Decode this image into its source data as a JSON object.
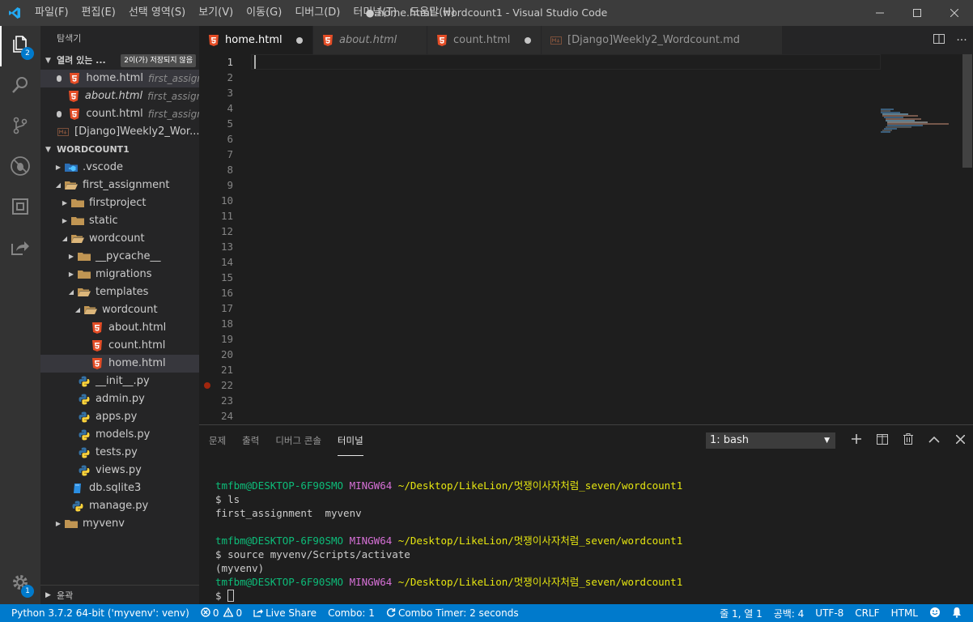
{
  "window": {
    "title": "● home.html - wordcount1 - Visual Studio Code",
    "menu": [
      "파일(F)",
      "편집(E)",
      "선택 영역(S)",
      "보기(V)",
      "이동(G)",
      "디버그(D)",
      "터미널(T)",
      "도움말(H)"
    ]
  },
  "activity": {
    "explorer_badge": "2",
    "settings_badge": "1"
  },
  "sidebar": {
    "title": "탐색기",
    "open_editors": {
      "label": "열려 있는 ...",
      "badge": "2이(가) 저장되지 않음",
      "items": [
        {
          "name": "home.html",
          "desc": "first_assign...",
          "dirty": true,
          "italic": false
        },
        {
          "name": "about.html",
          "desc": "first_assign...",
          "dirty": false,
          "italic": true
        },
        {
          "name": "count.html",
          "desc": "first_assign...",
          "dirty": true,
          "italic": false
        },
        {
          "name": "[Django]Weekly2_Wor...",
          "desc": "",
          "dirty": false,
          "italic": false
        }
      ]
    },
    "workspace": {
      "label": "WORDCOUNT1",
      "tree": [
        {
          "name": ".vscode",
          "depth": 0,
          "type": "vscode-folder",
          "open": false
        },
        {
          "name": "first_assignment",
          "depth": 0,
          "type": "folder",
          "open": true
        },
        {
          "name": "firstproject",
          "depth": 1,
          "type": "folder",
          "open": false
        },
        {
          "name": "static",
          "depth": 1,
          "type": "folder",
          "open": false
        },
        {
          "name": "wordcount",
          "depth": 1,
          "type": "folder",
          "open": true
        },
        {
          "name": "__pycache__",
          "depth": 2,
          "type": "folder",
          "open": false
        },
        {
          "name": "migrations",
          "depth": 2,
          "type": "folder",
          "open": false
        },
        {
          "name": "templates",
          "depth": 2,
          "type": "folder",
          "open": true
        },
        {
          "name": "wordcount",
          "depth": 3,
          "type": "folder",
          "open": true
        },
        {
          "name": "about.html",
          "depth": 4,
          "type": "html"
        },
        {
          "name": "count.html",
          "depth": 4,
          "type": "html"
        },
        {
          "name": "home.html",
          "depth": 4,
          "type": "html",
          "selected": true
        },
        {
          "name": "__init__.py",
          "depth": 2,
          "type": "python"
        },
        {
          "name": "admin.py",
          "depth": 2,
          "type": "python"
        },
        {
          "name": "apps.py",
          "depth": 2,
          "type": "python"
        },
        {
          "name": "models.py",
          "depth": 2,
          "type": "python"
        },
        {
          "name": "tests.py",
          "depth": 2,
          "type": "python"
        },
        {
          "name": "views.py",
          "depth": 2,
          "type": "python"
        },
        {
          "name": "db.sqlite3",
          "depth": 1,
          "type": "db"
        },
        {
          "name": "manage.py",
          "depth": 1,
          "type": "python"
        },
        {
          "name": "myvenv",
          "depth": 0,
          "type": "folder",
          "open": false
        }
      ]
    },
    "outline_label": "윤곽"
  },
  "tabs": [
    {
      "label": "home.html",
      "active": true,
      "italic": false,
      "dirty": true,
      "type": "html"
    },
    {
      "label": "about.html",
      "active": false,
      "italic": true,
      "dirty": false,
      "type": "html"
    },
    {
      "label": "count.html",
      "active": false,
      "italic": false,
      "dirty": true,
      "type": "html"
    },
    {
      "label": "[Django]Weekly2_Wordcount.md",
      "active": false,
      "italic": false,
      "dirty": false,
      "type": "md"
    }
  ],
  "editor": {
    "line_numbers": [
      "1",
      "2",
      "3",
      "4",
      "5",
      "6",
      "7",
      "8",
      "9",
      "10",
      "11",
      "12",
      "13",
      "14",
      "15",
      "16",
      "17",
      "18",
      "19",
      "20",
      "21",
      "22",
      "23",
      "24"
    ],
    "current_line": "1",
    "breakpoint_line": "22"
  },
  "panel": {
    "tabs": [
      "문제",
      "출력",
      "디버그 콘솔",
      "터미널"
    ],
    "active_tab": "터미널",
    "terminal_select": "1: bash",
    "terminal": {
      "user": "tmfbm@DESKTOP-6F90SMO",
      "env": "MINGW64",
      "path": "~/Desktop/LikeLion/멋쟁이사자처럼_seven/wordcount1",
      "prompt": "$",
      "cmd1": "ls",
      "out1": "first_assignment  myvenv",
      "cmd2": "source myvenv/Scripts/activate",
      "out2": "(myvenv)"
    }
  },
  "status": {
    "python": "Python 3.7.2 64-bit ('myvenv': venv)",
    "errors": "0",
    "warnings": "0",
    "live_share": "Live Share",
    "combo": "Combo: 1",
    "combo_timer": "Combo Timer: 2 seconds",
    "position": "줄 1, 열 1",
    "spaces": "공백: 4",
    "encoding": "UTF-8",
    "eol": "CRLF",
    "language": "HTML"
  },
  "colors": {
    "statusbar": "#007acc",
    "html_icon": "#e44d26",
    "folder_icon": "#c09553",
    "python_blue": "#3572a5",
    "python_yellow": "#ffd43b"
  }
}
